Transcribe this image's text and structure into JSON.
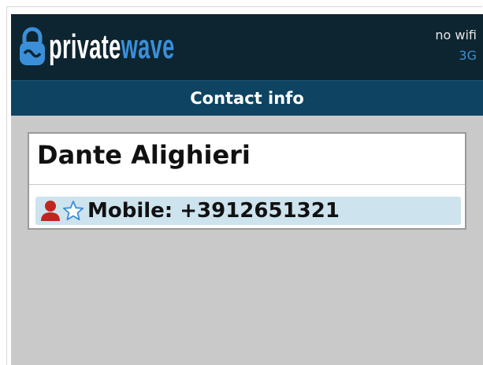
{
  "app": {
    "logo_text_private": "private",
    "logo_text_wave": "wave",
    "logo_icon": "lock-wave-icon"
  },
  "status": {
    "wifi": "no wifi",
    "network": "3G"
  },
  "header": {
    "title": "Contact info"
  },
  "contact": {
    "name": "Dante Alighieri",
    "phone_label": "Mobile:",
    "phone_number": "+3912651321",
    "phone_line": "Mobile: +3912651321",
    "icons": [
      "person-icon",
      "star-outline-icon"
    ]
  },
  "colors": {
    "topbar": "#0d2530",
    "titlebar": "#0e4461",
    "accent": "#3b8fd8",
    "background": "#c9c9c9",
    "selected_row": "#cde3ee",
    "person_icon": "#c0261e"
  }
}
